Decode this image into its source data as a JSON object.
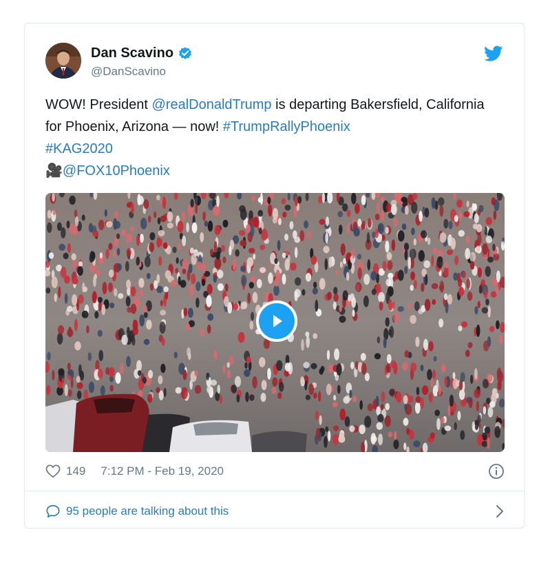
{
  "tweet": {
    "author_name": "Dan Scavino",
    "handle": "@DanScavino",
    "text_parts": {
      "p1": "WOW! President ",
      "mention1": "@realDonaldTrump",
      "p2": " is departing Bakersfield, California for Phoenix, Arizona — now! ",
      "hashtag1": "#TrumpRallyPhoenix",
      "hashtag2": "#KAG2020",
      "camera_emoji": "🎥",
      "mention2": "@FOX10Phoenix"
    },
    "likes": "149",
    "timestamp": "7:12 PM - Feb 19, 2020",
    "footer_text": "95 people are talking about this"
  },
  "colors": {
    "link": "#2b7bb9",
    "twitter_blue": "#1da1f2",
    "muted": "#657786",
    "border": "#e1e8ed"
  },
  "icons": [
    "verified-badge-icon",
    "twitter-bird-icon",
    "play-icon",
    "heart-icon",
    "info-icon",
    "speech-bubble-icon",
    "chevron-right-icon",
    "camera-icon"
  ]
}
